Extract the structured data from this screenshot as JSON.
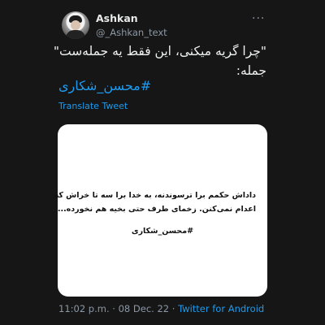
{
  "author": {
    "name": "Ashkan",
    "handle": "@_Ashkan_text"
  },
  "menu_label": "···",
  "tweet": {
    "line1": "\"چرا گریه میکنی، این فقط یه جمله‌ست\"",
    "line2": "جمله:",
    "hashtag": "#محسن_شکاری",
    "translate_label": "Translate Tweet"
  },
  "image_card": {
    "line1": "داداش حکمم برا ترسوندنه، به خدا برا سه تا خراش که",
    "line2": "اعدام نمی‌کنن. زخمای طرف حتی بخیه هم نخورده...",
    "hashtag": "#محسن_شکاری"
  },
  "meta": {
    "time": "11:02 p.m.",
    "separator": "·",
    "date": "08 Dec. 22",
    "separator2": "·",
    "app": "Twitter for Android"
  },
  "colors": {
    "background": "#161616",
    "link": "#1d9bf0",
    "secondary": "#8b98a5"
  }
}
